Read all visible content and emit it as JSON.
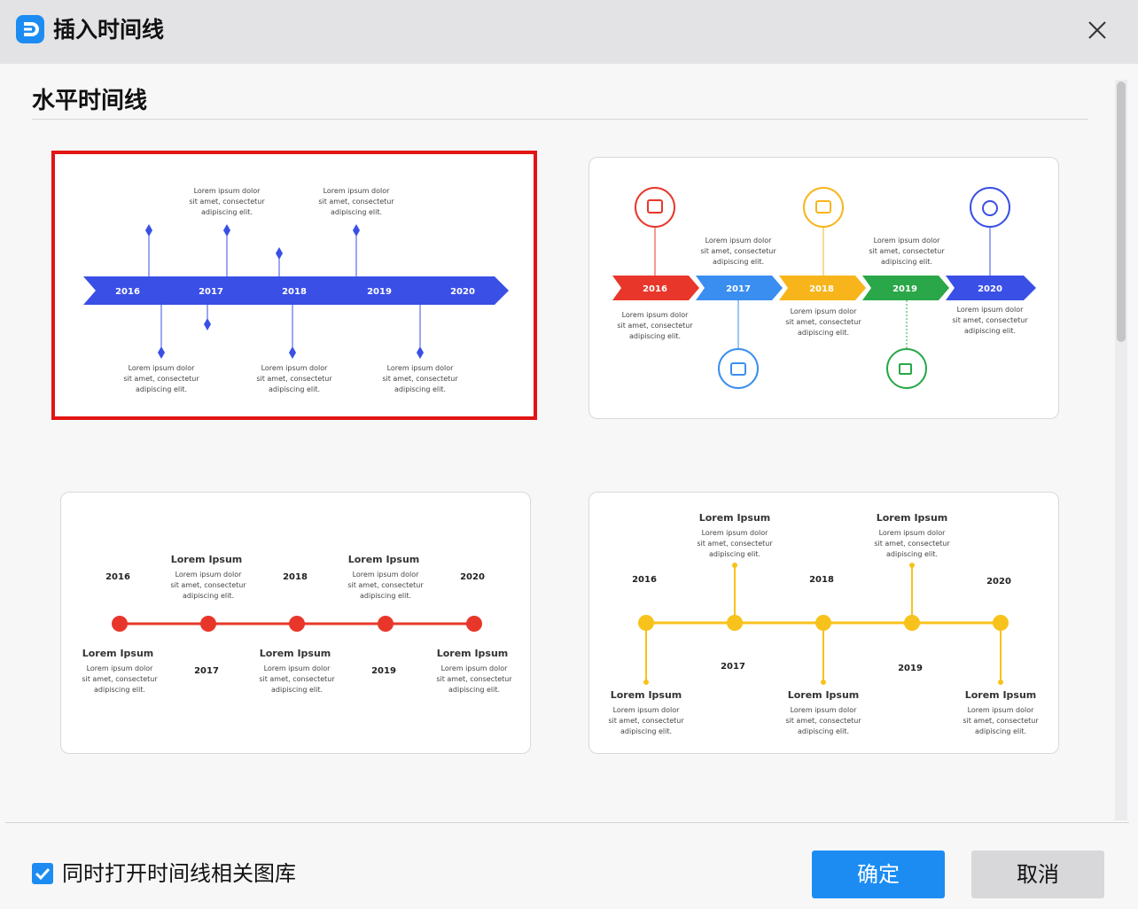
{
  "dialog": {
    "title": "插入时间线",
    "section_title": "水平时间线",
    "checkbox_label": "同时打开时间线相关图库",
    "checkbox_checked": true,
    "ok_label": "确定",
    "cancel_label": "取消"
  },
  "templates": [
    {
      "style": "blue-arrow-diamonds",
      "selected": true,
      "years": [
        "2016",
        "2017",
        "2018",
        "2019",
        "2020"
      ],
      "lorem_lines": [
        "Lorem ipsum dolor",
        "sit amet, consectetur",
        "adipiscing elit."
      ]
    },
    {
      "style": "colored-chevrons-icons",
      "selected": false,
      "years": [
        "2016",
        "2017",
        "2018",
        "2019",
        "2020"
      ],
      "lorem_lines": [
        "Lorem ipsum dolor",
        "sit amet, consectetur",
        "adipiscing elit."
      ]
    },
    {
      "style": "red-dots-line",
      "selected": false,
      "years": [
        "2016",
        "2017",
        "2018",
        "2019",
        "2020"
      ],
      "heading": "Lorem Ipsum",
      "lorem_lines": [
        "Lorem ipsum dolor",
        "sit amet, consectetur",
        "adipiscing elit."
      ]
    },
    {
      "style": "yellow-dots-stems",
      "selected": false,
      "years": [
        "2016",
        "2017",
        "2018",
        "2019",
        "2020"
      ],
      "heading": "Lorem Ipsum",
      "lorem_lines": [
        "Lorem ipsum dolor",
        "sit amet, consectetur",
        "adipiscing elit."
      ]
    }
  ],
  "colors": {
    "accent": "#1c8cf3",
    "selection": "#e21414",
    "blue_timeline": "#3a4fe6",
    "red_timeline": "#e8372a",
    "yellow_timeline": "#f7c21b",
    "chevrons": [
      "#e8372a",
      "#3a8ef0",
      "#f7b51b",
      "#2aa748",
      "#3a4fe6"
    ]
  }
}
